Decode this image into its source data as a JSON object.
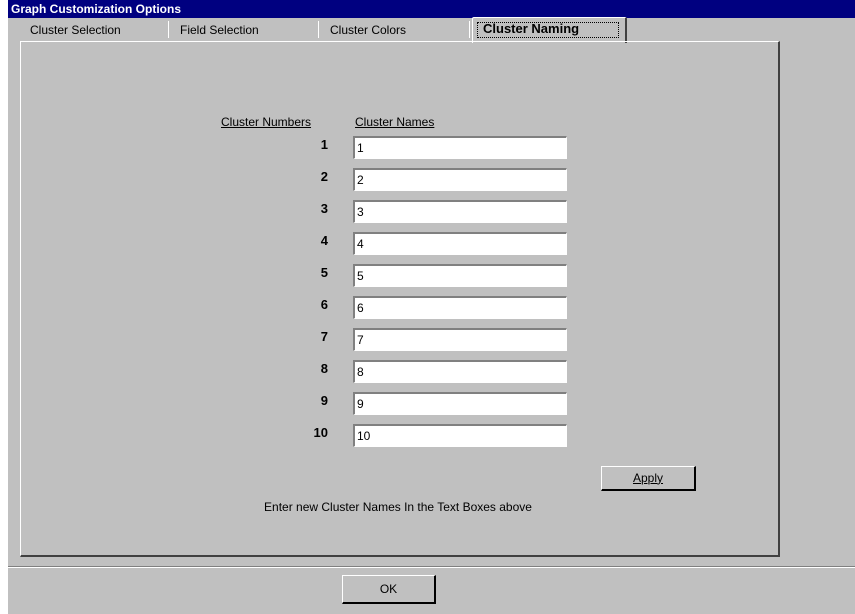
{
  "window": {
    "title": "Graph Customization Options"
  },
  "tabs": [
    {
      "label": "Cluster Selection",
      "active": false
    },
    {
      "label": "Field Selection",
      "active": false
    },
    {
      "label": "Cluster Colors",
      "active": false
    },
    {
      "label": "Cluster Naming",
      "active": true
    }
  ],
  "naming": {
    "col_numbers": "Cluster Numbers",
    "col_names": "Cluster Names",
    "rows": [
      {
        "number": "1",
        "name": "1"
      },
      {
        "number": "2",
        "name": "2"
      },
      {
        "number": "3",
        "name": "3"
      },
      {
        "number": "4",
        "name": "4"
      },
      {
        "number": "5",
        "name": "5"
      },
      {
        "number": "6",
        "name": "6"
      },
      {
        "number": "7",
        "name": "7"
      },
      {
        "number": "8",
        "name": "8"
      },
      {
        "number": "9",
        "name": "9"
      },
      {
        "number": "10",
        "name": "10"
      }
    ],
    "apply_label": "Apply",
    "hint": "Enter new Cluster Names In the Text Boxes above"
  },
  "footer": {
    "ok_label": "OK"
  },
  "colors": {
    "titlebar": "#000080",
    "face": "#c0c0c0"
  }
}
